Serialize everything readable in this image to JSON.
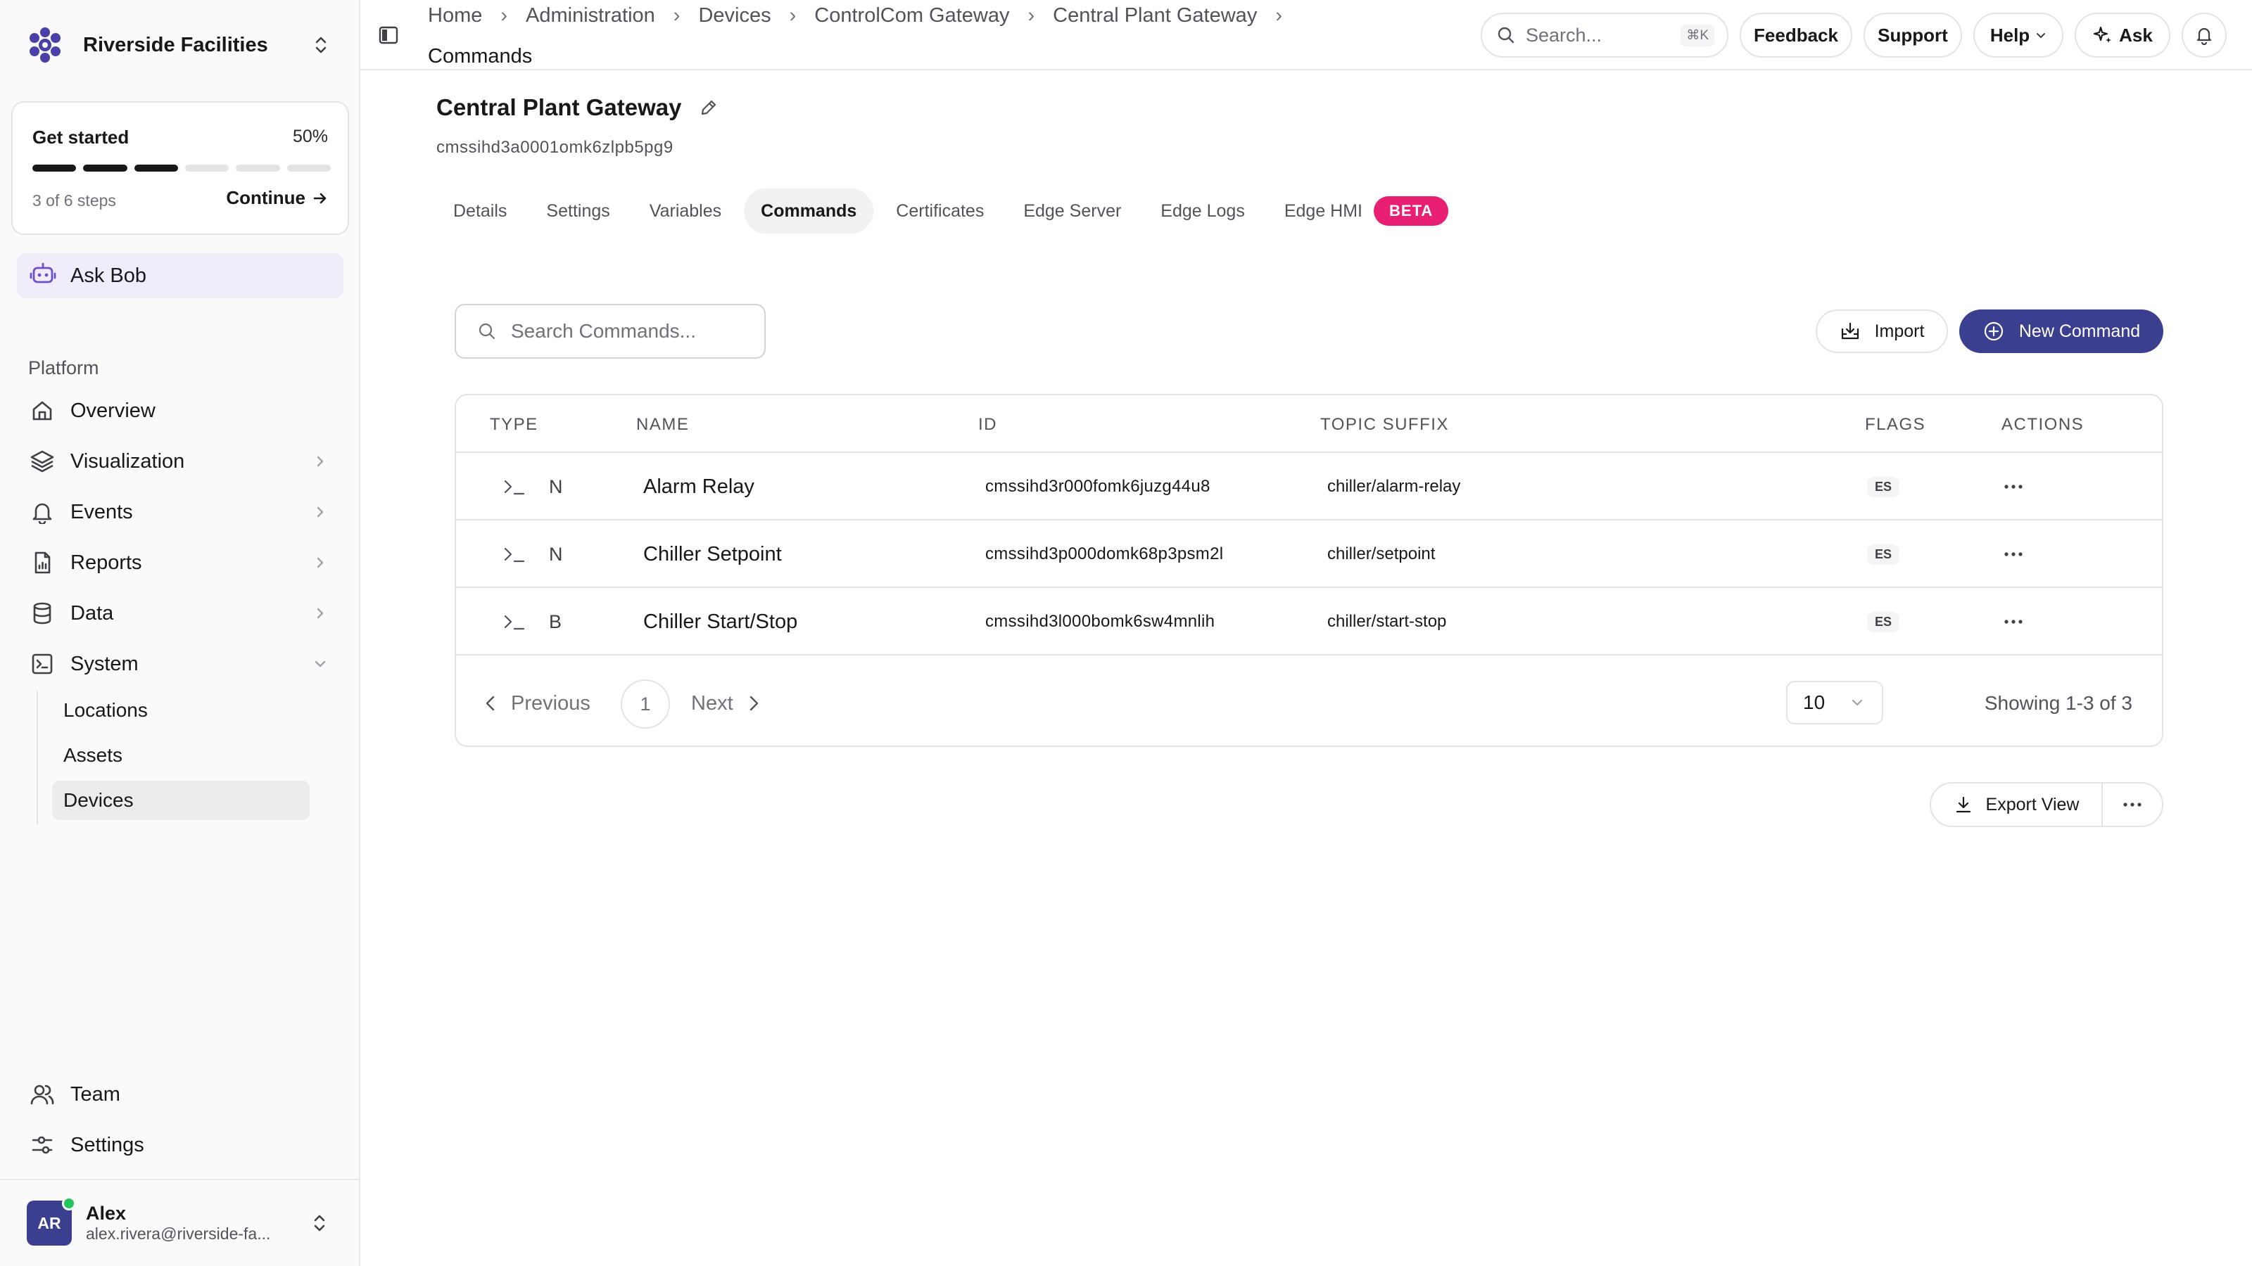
{
  "org": {
    "name": "Riverside Facilities"
  },
  "getting_started": {
    "title": "Get started",
    "percent_label": "50%",
    "progress": 0.5,
    "steps_label": "3 of 6 steps",
    "continue_label": "Continue"
  },
  "ask_bob": {
    "label": "Ask Bob"
  },
  "sidebar": {
    "section_label": "Platform",
    "items": [
      {
        "label": "Overview",
        "icon": "home-icon"
      },
      {
        "label": "Visualization",
        "icon": "layers-icon"
      },
      {
        "label": "Events",
        "icon": "bell-icon"
      },
      {
        "label": "Reports",
        "icon": "report-icon"
      },
      {
        "label": "Data",
        "icon": "database-icon"
      },
      {
        "label": "System",
        "icon": "terminal-square-icon"
      }
    ],
    "system_children": [
      {
        "label": "Locations"
      },
      {
        "label": "Assets"
      },
      {
        "label": "Devices",
        "active": true
      }
    ],
    "bottom_items": [
      {
        "label": "Team",
        "icon": "users-icon"
      },
      {
        "label": "Settings",
        "icon": "sliders-icon"
      }
    ]
  },
  "user": {
    "initials": "AR",
    "name": "Alex",
    "email": "alex.rivera@riverside-fa..."
  },
  "breadcrumb": {
    "items": [
      "Home",
      "Administration",
      "Devices",
      "ControlCom Gateway",
      "Central Plant Gateway"
    ],
    "current": "Commands"
  },
  "topbar": {
    "search_placeholder": "Search...",
    "search_shortcut": "⌘K",
    "feedback_label": "Feedback",
    "support_label": "Support",
    "help_label": "Help",
    "ask_label": "Ask"
  },
  "page": {
    "title": "Central Plant Gateway",
    "id": "cmssihd3a0001omk6zlpb5pg9"
  },
  "tabs": [
    {
      "label": "Details"
    },
    {
      "label": "Settings"
    },
    {
      "label": "Variables"
    },
    {
      "label": "Commands",
      "active": true
    },
    {
      "label": "Certificates"
    },
    {
      "label": "Edge Server"
    },
    {
      "label": "Edge Logs"
    },
    {
      "label": "Edge HMI",
      "badge": "BETA"
    }
  ],
  "commands": {
    "search_placeholder": "Search Commands...",
    "import_label": "Import",
    "new_label": "New Command",
    "columns": {
      "type": "TYPE",
      "name": "NAME",
      "id": "ID",
      "topic": "TOPIC SUFFIX",
      "flags": "FLAGS",
      "actions": "ACTIONS"
    },
    "rows": [
      {
        "type": "N",
        "name": "Alarm Relay",
        "id": "cmssihd3r000fomk6juzg44u8",
        "topic": "chiller/alarm-relay",
        "flag": "ES"
      },
      {
        "type": "N",
        "name": "Chiller Setpoint",
        "id": "cmssihd3p000domk68p3psm2l",
        "topic": "chiller/setpoint",
        "flag": "ES"
      },
      {
        "type": "B",
        "name": "Chiller Start/Stop",
        "id": "cmssihd3l000bomk6sw4mnlih",
        "topic": "chiller/start-stop",
        "flag": "ES"
      }
    ],
    "pagination": {
      "prev_label": "Previous",
      "page": "1",
      "next_label": "Next",
      "page_size": "10",
      "showing": "Showing 1-3 of 3"
    },
    "export_label": "Export View"
  },
  "colors": {
    "accent": "#3b3f8f",
    "beta": "#e81f73",
    "ask_bob_bg": "#f1ecfa",
    "logo": "#4b3fa8"
  }
}
